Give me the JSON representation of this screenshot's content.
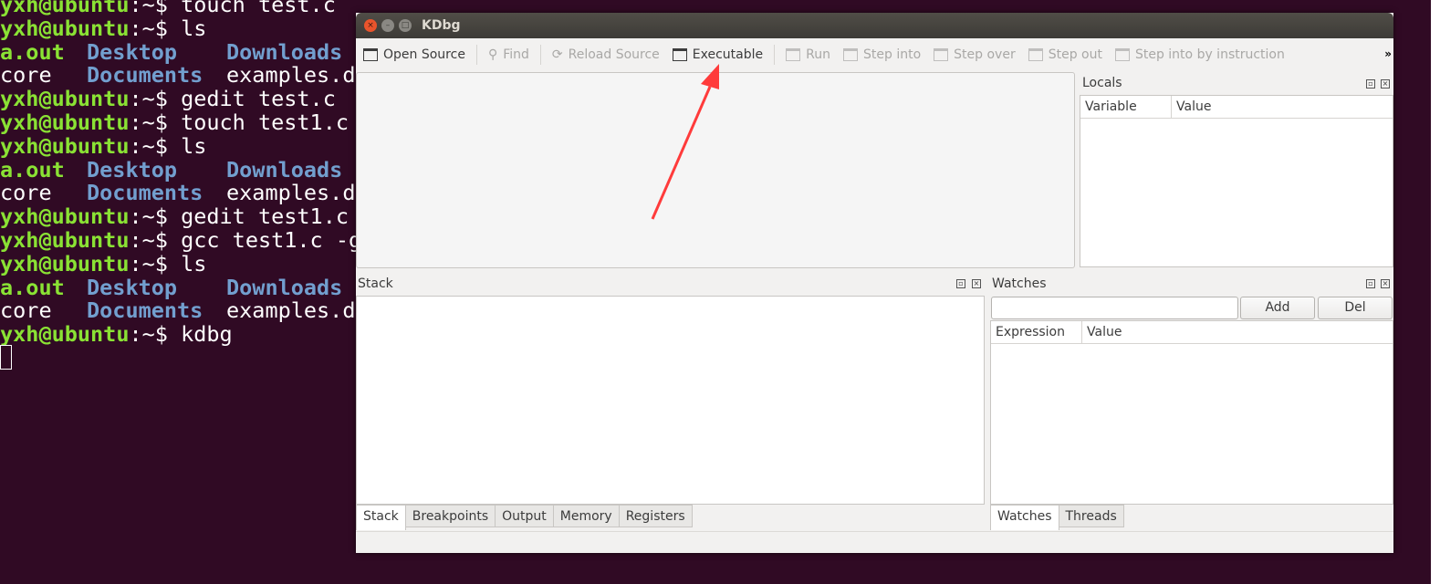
{
  "terminal": {
    "prompt": "yxh@ubuntu",
    "prompt_suffix": ":~$ ",
    "lines": [
      {
        "type": "cmd",
        "text": "touch test.c"
      },
      {
        "type": "cmd",
        "text": "ls"
      },
      {
        "type": "ls",
        "cols": [
          "a.out",
          "Desktop",
          "Downloads"
        ]
      },
      {
        "type": "ls",
        "cols": [
          "core",
          "Documents",
          "examples.d"
        ]
      },
      {
        "type": "cmd",
        "text": "gedit test.c"
      },
      {
        "type": "cmd",
        "text": "touch test1.c"
      },
      {
        "type": "cmd",
        "text": "ls"
      },
      {
        "type": "ls",
        "cols": [
          "a.out",
          "Desktop",
          "Downloads"
        ]
      },
      {
        "type": "ls",
        "cols": [
          "core",
          "Documents",
          "examples.d"
        ]
      },
      {
        "type": "cmd",
        "text": "gedit test1.c"
      },
      {
        "type": "cmd",
        "text": "gcc test1.c -g"
      },
      {
        "type": "cmd",
        "text": "ls"
      },
      {
        "type": "ls",
        "cols": [
          "a.out",
          "Desktop",
          "Downloads"
        ]
      },
      {
        "type": "ls",
        "cols": [
          "core",
          "Documents",
          "examples.d"
        ]
      },
      {
        "type": "cmd",
        "text": "kdbg"
      }
    ]
  },
  "window": {
    "title": "KDbg"
  },
  "toolbar": {
    "open_source": "Open Source",
    "find": "Find",
    "reload_source": "Reload Source",
    "executable": "Executable",
    "run": "Run",
    "step_into": "Step into",
    "step_over": "Step over",
    "step_out": "Step out",
    "step_into_instruction": "Step into by instruction",
    "overflow": "»"
  },
  "locals": {
    "title": "Locals",
    "columns": [
      "Variable",
      "Value"
    ]
  },
  "stack": {
    "title": "Stack",
    "tabs": [
      "Stack",
      "Breakpoints",
      "Output",
      "Memory",
      "Registers"
    ]
  },
  "watches": {
    "title": "Watches",
    "input_value": "",
    "add": "Add",
    "del": "Del",
    "columns": [
      "Expression",
      "Value"
    ],
    "tabs": [
      "Watches",
      "Threads"
    ]
  },
  "colors": {
    "terminal_bg": "#300a24",
    "prompt": "#8ae234",
    "directory": "#729fcf",
    "arrow": "#ff3b3b"
  }
}
